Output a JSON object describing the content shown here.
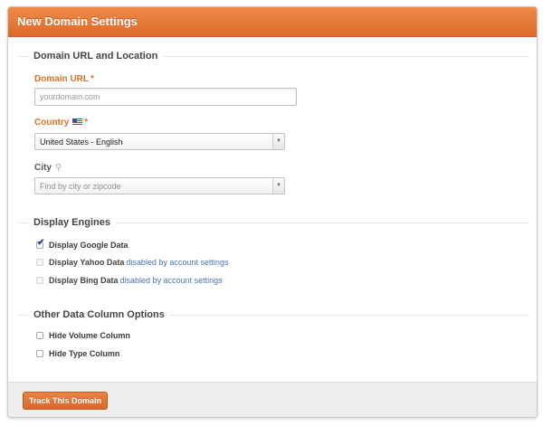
{
  "panel": {
    "title": "New Domain Settings"
  },
  "location": {
    "legend": "Domain URL and Location",
    "domain_label": "Domain URL",
    "domain_required": "*",
    "domain_placeholder": "yourdomain.com",
    "country_label": "Country",
    "country_required": "*",
    "country_value": "United States - English",
    "city_label": "City",
    "city_placeholder": "Find by city or zipcode"
  },
  "engines": {
    "legend": "Display Engines",
    "items": [
      {
        "label": "Display Google Data",
        "checked": true,
        "disabled": false
      },
      {
        "label": "Display Yahoo Data",
        "note": "disabled by account settings",
        "checked": false,
        "disabled": true
      },
      {
        "label": "Display Bing Data",
        "note": "disabled by account settings",
        "checked": false,
        "disabled": true
      }
    ]
  },
  "other": {
    "legend": "Other Data Column Options",
    "items": [
      {
        "label": "Hide Volume Column",
        "checked": false
      },
      {
        "label": "Hide Type Column",
        "checked": false
      }
    ]
  },
  "footer": {
    "submit_label": "Track This Domain"
  },
  "colors": {
    "accent": "#e27535",
    "link": "#4a74b5",
    "check": "#2a3f86"
  },
  "icons": {
    "country": "us-flag-icon",
    "city": "map-pin-icon",
    "select": "chevron-down-icon",
    "checked": "check-icon"
  }
}
